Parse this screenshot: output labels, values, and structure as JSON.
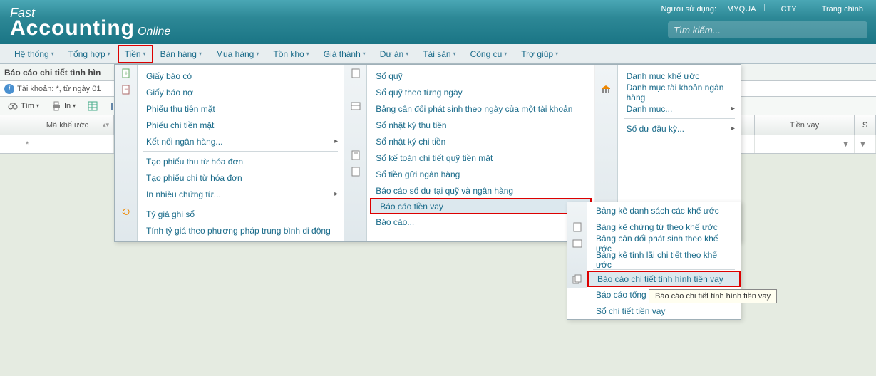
{
  "header": {
    "user_label": "Người sử dụng:",
    "user_name": "MYQUA",
    "company": "CTY",
    "home": "Trang chính",
    "logo_fast": "Fast",
    "logo_acc": "Accounting",
    "logo_online": "Online",
    "search_placeholder": "Tìm kiếm..."
  },
  "menubar": [
    {
      "label": "Hệ thống"
    },
    {
      "label": "Tổng hợp"
    },
    {
      "label": "Tiền",
      "active": true
    },
    {
      "label": "Bán hàng"
    },
    {
      "label": "Mua hàng"
    },
    {
      "label": "Tồn kho"
    },
    {
      "label": "Giá thành"
    },
    {
      "label": "Dự án"
    },
    {
      "label": "Tài sản"
    },
    {
      "label": "Công cụ"
    },
    {
      "label": "Trợ giúp"
    }
  ],
  "titlebar": "Báo cáo chi tiết tình hìn",
  "info_text": "Tài khoản: *, từ ngày 01",
  "actions": {
    "find": "Tìm",
    "in": "In"
  },
  "columns": {
    "makheuoc": "Mã khế ước",
    "tienvay": "Tiền vay",
    "s": "S"
  },
  "filter_star": "*",
  "dropdown": {
    "col1": [
      "Giấy báo có",
      "Giấy báo nợ",
      "Phiếu thu tiền mặt",
      "Phiếu chi tiền mặt",
      "Kết nối ngân hàng...",
      "Tạo phiếu thu từ hóa đơn",
      "Tạo phiếu chi từ hóa đơn",
      "In nhiều chứng từ...",
      "Tỷ giá ghi sổ",
      "Tính tỷ giá theo phương pháp trung bình di động"
    ],
    "col2": [
      "Sổ quỹ",
      "Sổ quỹ theo từng ngày",
      "Bảng cân đối phát sinh theo ngày của một tài khoản",
      "Sổ nhật ký thu tiền",
      "Sổ nhật ký chi tiền",
      "Sổ kế toán chi tiết quỹ tiền mặt",
      "Sổ tiền gửi ngân hàng",
      "Báo cáo số dư tại quỹ và ngân hàng",
      "Báo cáo tiền vay",
      "Báo cáo..."
    ],
    "col3": [
      "Danh mục khế ước",
      "Danh mục tài khoản ngân hàng",
      "Danh mục...",
      "Số dư đầu kỳ..."
    ]
  },
  "submenu": [
    "Bảng kê danh sách các khế ước",
    "Bảng kê chứng từ theo khế ước",
    "Bảng cân đối phát sinh theo khế ước",
    "Bảng kê tính lãi chi tiết theo khế ước",
    "Báo cáo chi tiết tình hình tiền vay",
    "Báo cáo tổng hợp",
    "Sổ chi tiết tiền vay"
  ],
  "tooltip": "Báo cáo chi tiết tình hình tiền vay"
}
